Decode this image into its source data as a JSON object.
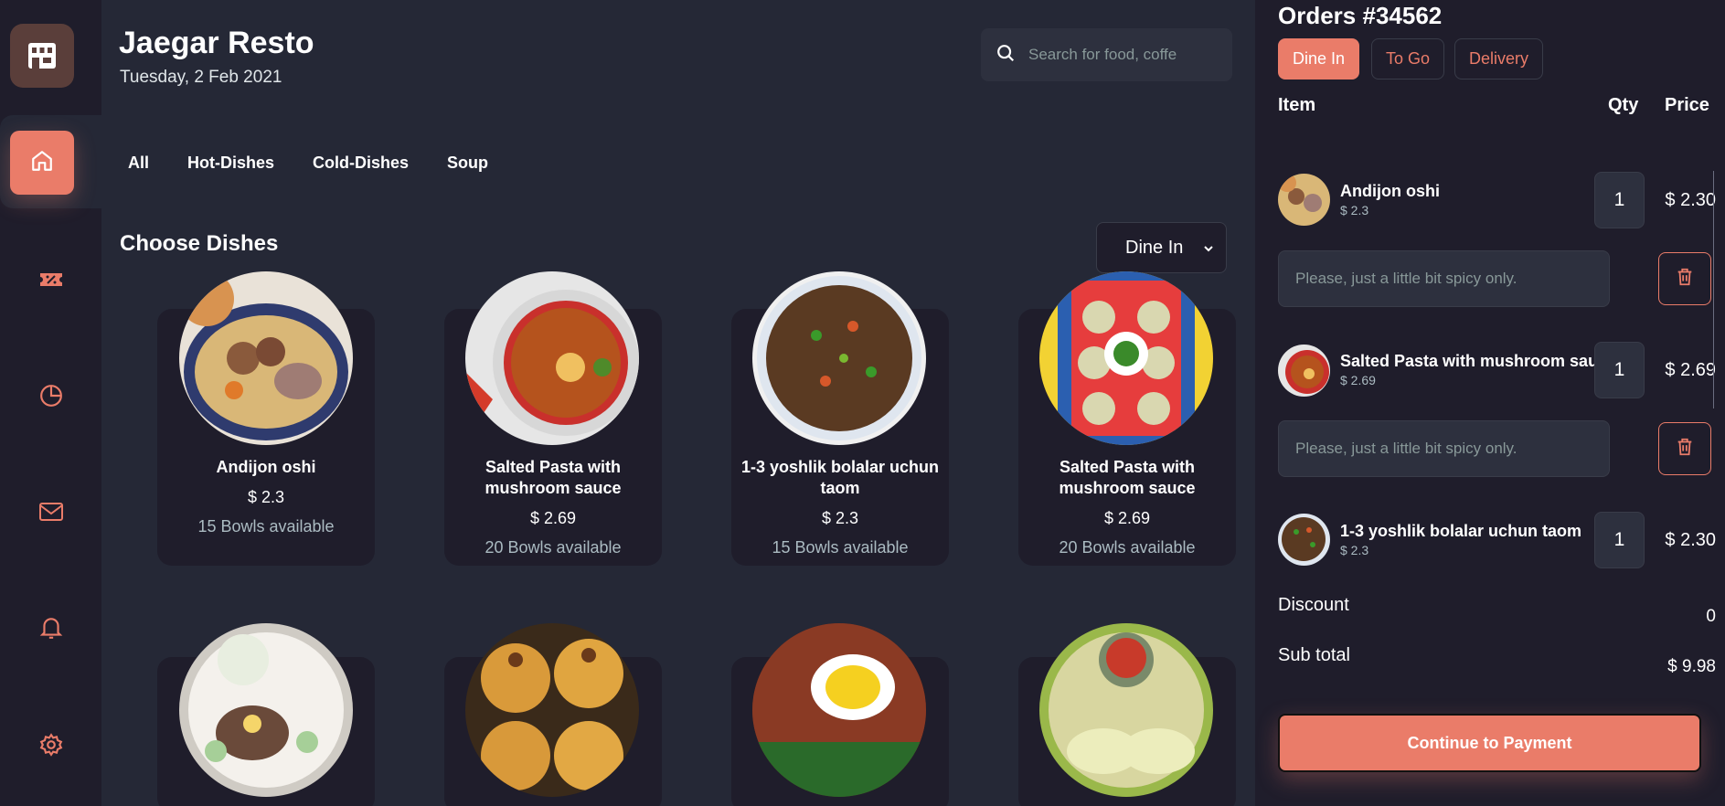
{
  "header": {
    "title": "Jaegar Resto",
    "date": "Tuesday, 2 Feb 2021",
    "search_placeholder": "Search for food, coffe"
  },
  "sidebar": {
    "items": [
      {
        "icon": "home-icon"
      },
      {
        "icon": "discount-icon"
      },
      {
        "icon": "dashboard-icon"
      },
      {
        "icon": "message-icon"
      },
      {
        "icon": "notification-icon"
      },
      {
        "icon": "settings-icon"
      }
    ]
  },
  "tabs": [
    "All",
    "Hot-Dishes",
    "Cold-Dishes",
    "Soup"
  ],
  "section_title": "Choose Dishes",
  "service_select": "Dine In",
  "dishes": [
    {
      "name": "Andijon oshi",
      "price": "$ 2.3",
      "available": "15 Bowls available"
    },
    {
      "name": "Salted Pasta with mushroom sauce",
      "price": "$ 2.69",
      "available": "20 Bowls available"
    },
    {
      "name": "1-3 yoshlik bolalar uchun taom",
      "price": "$ 2.3",
      "available": "15 Bowls available"
    },
    {
      "name": "Salted Pasta with mushroom sauce",
      "price": "$ 2.69",
      "available": "20 Bowls available"
    }
  ],
  "orders": {
    "title": "Orders #34562",
    "tabs": [
      "Dine In",
      "To Go",
      "Delivery"
    ],
    "col_item": "Item",
    "col_qty": "Qty",
    "col_price": "Price",
    "items": [
      {
        "name": "Andijon oshi",
        "unit_price": "$ 2.3",
        "qty": "1",
        "total": "$ 2.30",
        "note": "Please, just a little bit spicy only."
      },
      {
        "name": "Salted Pasta with mushroom sauce",
        "unit_price": "$ 2.69",
        "qty": "1",
        "total": "$ 2.69",
        "note": "Please, just a little bit spicy only."
      },
      {
        "name": "1-3 yoshlik bolalar uchun taom",
        "unit_price": "$ 2.3",
        "qty": "1",
        "total": "$ 2.30"
      }
    ],
    "discount_label": "Discount",
    "discount_value": "0",
    "subtotal_label": "Sub total",
    "subtotal_value": "$ 9.98",
    "pay_label": "Continue to Payment"
  },
  "colors": {
    "accent": "#EA7C69",
    "bg": "#252836",
    "panel": "#1F1D2B"
  }
}
